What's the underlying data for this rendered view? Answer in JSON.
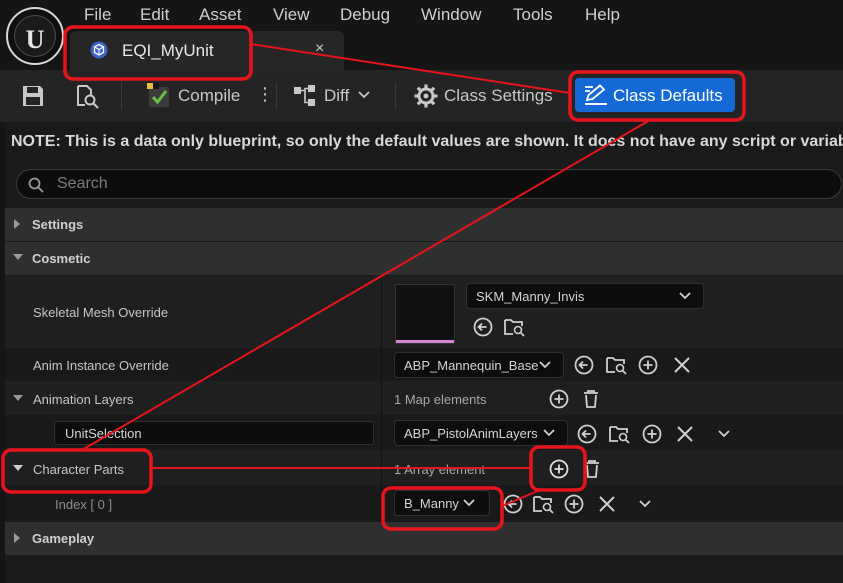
{
  "menu": {
    "logo_mark": "U",
    "items": [
      "File",
      "Edit",
      "Asset",
      "View",
      "Debug",
      "Window",
      "Tools",
      "Help"
    ]
  },
  "tab": {
    "label": "EQI_MyUnit",
    "close_glyph": "×"
  },
  "toolbar": {
    "compile_label": "Compile",
    "more_glyph": "⋮",
    "diff_label": "Diff",
    "class_settings_label": "Class Settings",
    "class_defaults_label": "Class Defaults"
  },
  "details": {
    "note": "NOTE: This is a data only blueprint, so only the default values are shown.  It does not have any script or variables.",
    "search_placeholder": "Search",
    "categories": {
      "settings": "Settings",
      "cosmetic": "Cosmetic",
      "gameplay": "Gameplay"
    },
    "skeletal_mesh_override": {
      "label": "Skeletal Mesh Override",
      "value": "SKM_Manny_Invis"
    },
    "anim_instance_override": {
      "label": "Anim Instance Override",
      "value": "ABP_Mannequin_Base"
    },
    "animation_layers": {
      "label": "Animation Layers",
      "count": "1 Map elements",
      "key": "UnitSelection",
      "value": "ABP_PistolAnimLayers"
    },
    "character_parts": {
      "label": "Character Parts",
      "count": "1 Array element",
      "index_label": "Index [ 0 ]",
      "value": "B_Manny"
    }
  },
  "colors": {
    "accent_button": "#1469d6",
    "annotation": "#e8141c",
    "thumbnail_bar": "#d885d8"
  }
}
